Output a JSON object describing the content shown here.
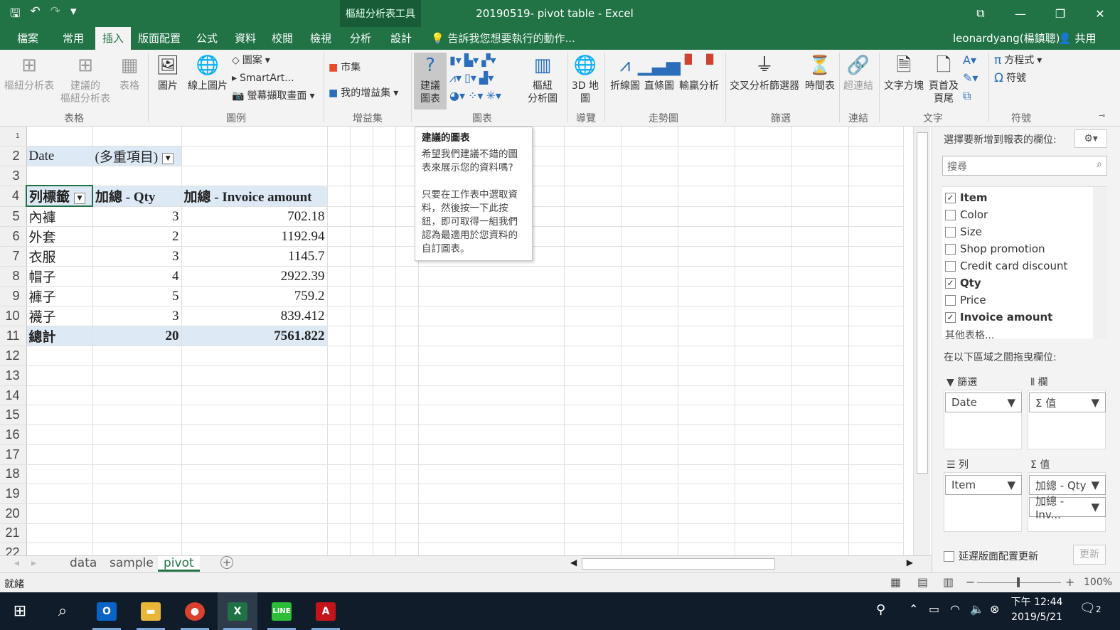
{
  "window": {
    "title": "20190519- pivot table - Excel",
    "context_tab": "樞紐分析表工具",
    "controls": [
      "⧉",
      "—",
      "❐",
      "✕"
    ]
  },
  "qat": {
    "save": "🖫",
    "undo": "↶",
    "redo": "↷",
    "more": "▾"
  },
  "menu": {
    "tabs": [
      "檔案",
      "常用",
      "插入",
      "版面配置",
      "公式",
      "資料",
      "校閱",
      "檢視",
      "分析",
      "設計"
    ],
    "active": "插入",
    "tell_me": "告訴我您想要執行的動作...",
    "user": "leonardyang(楊鎮聰)",
    "share": "共用"
  },
  "ribbon": {
    "buttons": [
      "樞紐分析表",
      "建議的\n樞紐分析表",
      "表格",
      "圖片",
      "線上圖片",
      "建議\n圖表",
      "樞紐\n分析圖",
      "3D 地\n圖",
      "折線圖",
      "直條圖",
      "輸贏分析",
      "交叉分析篩選器",
      "時間表",
      "超連結",
      "文字方塊",
      "頁首及\n頁尾"
    ],
    "small": [
      "圖案",
      "SmartArt...",
      "螢幕擷取畫面",
      "市集",
      "我的增益集",
      "方程式",
      "符號"
    ],
    "groups": [
      "表格",
      "圖例",
      "增益集",
      "圖表",
      "導覽",
      "走勢圖",
      "篩選",
      "連結",
      "文字",
      "符號"
    ]
  },
  "sheet": {
    "row_numbers": [
      "1",
      "2",
      "3",
      "4",
      "5",
      "6",
      "7",
      "8",
      "9",
      "10",
      "11",
      "12",
      "13",
      "14",
      "15",
      "16",
      "17",
      "18",
      "19",
      "20",
      "21",
      "22"
    ],
    "filter": {
      "label": "Date",
      "value": "(多重項目)"
    },
    "headers": [
      "列標籤",
      "加總 - Qty",
      "加總 - Invoice amount"
    ],
    "rows": [
      [
        "內褲",
        "3",
        "702.18"
      ],
      [
        "外套",
        "2",
        "1192.94"
      ],
      [
        "衣服",
        "3",
        "1145.7"
      ],
      [
        "帽子",
        "4",
        "2922.39"
      ],
      [
        "褲子",
        "5",
        "759.2"
      ],
      [
        "襪子",
        "3",
        "839.412"
      ]
    ],
    "total": [
      "總計",
      "20",
      "7561.822"
    ]
  },
  "tooltip": {
    "title": "建議的圖表",
    "p1": "希望我們建議不錯的圖表來展示您的資料嗎?",
    "p2": "只要在工作表中選取資料，然後按一下此按鈕，即可取得一組我們認為最適用於您資料的自訂圖表。"
  },
  "pane": {
    "header": "選擇要新增到報表的欄位:",
    "search_placeholder": "搜尋",
    "fields": [
      {
        "name": "Item",
        "checked": true
      },
      {
        "name": "Color",
        "checked": false
      },
      {
        "name": "Size",
        "checked": false
      },
      {
        "name": "Shop promotion",
        "checked": false
      },
      {
        "name": "Credit card discount",
        "checked": false
      },
      {
        "name": "Qty",
        "checked": true
      },
      {
        "name": "Price",
        "checked": false
      },
      {
        "name": "Invoice amount",
        "checked": true
      }
    ],
    "more_tables": "其他表格...",
    "drag_label": "在以下區域之間拖曳欄位:",
    "zones": {
      "filters": "篩選",
      "columns": "欄",
      "rows": "列",
      "values": "值"
    },
    "zone_items": {
      "filter": "Date",
      "column": "Σ 值",
      "row": "Item",
      "values": [
        "加總 - Qty",
        "加總 - Inv..."
      ]
    },
    "defer": "延遲版面配置更新",
    "update": "更新"
  },
  "sheet_tabs": [
    "data",
    "sample",
    "pivot"
  ],
  "active_sheet": "pivot",
  "status": {
    "left": "就緒",
    "zoom": "100%"
  },
  "taskbar": {
    "time": "下午 12:44",
    "date": "2019/5/21",
    "notifications": "2"
  },
  "colors": {
    "excel_green": "#217346",
    "selection": "#dde9f5"
  }
}
